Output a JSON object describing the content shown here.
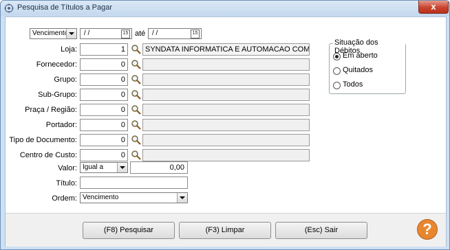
{
  "window": {
    "title": "Pesquisa de Títulos a Pagar",
    "close_label": "x",
    "app_icon": "app-gear-icon"
  },
  "date_filter": {
    "type": "Vencimento",
    "from": "/ /",
    "to_label": "até",
    "to": "/ /",
    "calendar_text": "15"
  },
  "fields": [
    {
      "key": "loja",
      "label": "Loja:",
      "value": "1",
      "description": "SYNDATA INFORMATICA E AUTOMACAO COMERC"
    },
    {
      "key": "fornecedor",
      "label": "Fornecedor:",
      "value": "0",
      "description": ""
    },
    {
      "key": "grupo",
      "label": "Grupo:",
      "value": "0",
      "description": ""
    },
    {
      "key": "sub-grupo",
      "label": "Sub-Grupo:",
      "value": "0",
      "description": ""
    },
    {
      "key": "praca-regiao",
      "label": "Praça / Região:",
      "value": "0",
      "description": ""
    },
    {
      "key": "portador",
      "label": "Portador:",
      "value": "0",
      "description": ""
    },
    {
      "key": "tipo-documento",
      "label": "Tipo de Documento:",
      "value": "0",
      "description": ""
    },
    {
      "key": "centro-custo",
      "label": "Centro de Custo:",
      "value": "0",
      "description": ""
    }
  ],
  "valor": {
    "label": "Valor:",
    "operator": "Igual a",
    "amount": "0,00"
  },
  "titulo": {
    "label": "Título:",
    "value": ""
  },
  "ordem": {
    "label": "Ordem:",
    "value": "Vencimento"
  },
  "situacao": {
    "title": "Situação dos Débitos",
    "options": [
      {
        "label": "Em aberto",
        "selected": true
      },
      {
        "label": "Quitados",
        "selected": false
      },
      {
        "label": "Todos",
        "selected": false
      }
    ]
  },
  "buttons": {
    "search": "(F8) Pesquisar",
    "clear": "(F3) Limpar",
    "exit": "(Esc) Sair"
  },
  "help": {
    "glyph": "?"
  }
}
